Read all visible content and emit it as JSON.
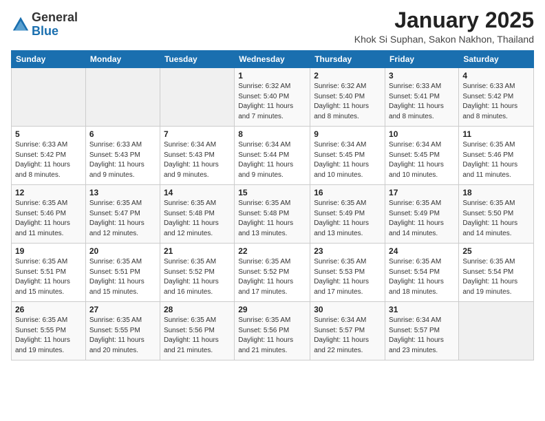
{
  "logo": {
    "general": "General",
    "blue": "Blue"
  },
  "header": {
    "title": "January 2025",
    "subtitle": "Khok Si Suphan, Sakon Nakhon, Thailand"
  },
  "weekdays": [
    "Sunday",
    "Monday",
    "Tuesday",
    "Wednesday",
    "Thursday",
    "Friday",
    "Saturday"
  ],
  "weeks": [
    [
      {
        "day": "",
        "content": ""
      },
      {
        "day": "",
        "content": ""
      },
      {
        "day": "",
        "content": ""
      },
      {
        "day": "1",
        "content": "Sunrise: 6:32 AM\nSunset: 5:40 PM\nDaylight: 11 hours and 7 minutes."
      },
      {
        "day": "2",
        "content": "Sunrise: 6:32 AM\nSunset: 5:40 PM\nDaylight: 11 hours and 8 minutes."
      },
      {
        "day": "3",
        "content": "Sunrise: 6:33 AM\nSunset: 5:41 PM\nDaylight: 11 hours and 8 minutes."
      },
      {
        "day": "4",
        "content": "Sunrise: 6:33 AM\nSunset: 5:42 PM\nDaylight: 11 hours and 8 minutes."
      }
    ],
    [
      {
        "day": "5",
        "content": "Sunrise: 6:33 AM\nSunset: 5:42 PM\nDaylight: 11 hours and 8 minutes."
      },
      {
        "day": "6",
        "content": "Sunrise: 6:33 AM\nSunset: 5:43 PM\nDaylight: 11 hours and 9 minutes."
      },
      {
        "day": "7",
        "content": "Sunrise: 6:34 AM\nSunset: 5:43 PM\nDaylight: 11 hours and 9 minutes."
      },
      {
        "day": "8",
        "content": "Sunrise: 6:34 AM\nSunset: 5:44 PM\nDaylight: 11 hours and 9 minutes."
      },
      {
        "day": "9",
        "content": "Sunrise: 6:34 AM\nSunset: 5:45 PM\nDaylight: 11 hours and 10 minutes."
      },
      {
        "day": "10",
        "content": "Sunrise: 6:34 AM\nSunset: 5:45 PM\nDaylight: 11 hours and 10 minutes."
      },
      {
        "day": "11",
        "content": "Sunrise: 6:35 AM\nSunset: 5:46 PM\nDaylight: 11 hours and 11 minutes."
      }
    ],
    [
      {
        "day": "12",
        "content": "Sunrise: 6:35 AM\nSunset: 5:46 PM\nDaylight: 11 hours and 11 minutes."
      },
      {
        "day": "13",
        "content": "Sunrise: 6:35 AM\nSunset: 5:47 PM\nDaylight: 11 hours and 12 minutes."
      },
      {
        "day": "14",
        "content": "Sunrise: 6:35 AM\nSunset: 5:48 PM\nDaylight: 11 hours and 12 minutes."
      },
      {
        "day": "15",
        "content": "Sunrise: 6:35 AM\nSunset: 5:48 PM\nDaylight: 11 hours and 13 minutes."
      },
      {
        "day": "16",
        "content": "Sunrise: 6:35 AM\nSunset: 5:49 PM\nDaylight: 11 hours and 13 minutes."
      },
      {
        "day": "17",
        "content": "Sunrise: 6:35 AM\nSunset: 5:49 PM\nDaylight: 11 hours and 14 minutes."
      },
      {
        "day": "18",
        "content": "Sunrise: 6:35 AM\nSunset: 5:50 PM\nDaylight: 11 hours and 14 minutes."
      }
    ],
    [
      {
        "day": "19",
        "content": "Sunrise: 6:35 AM\nSunset: 5:51 PM\nDaylight: 11 hours and 15 minutes."
      },
      {
        "day": "20",
        "content": "Sunrise: 6:35 AM\nSunset: 5:51 PM\nDaylight: 11 hours and 15 minutes."
      },
      {
        "day": "21",
        "content": "Sunrise: 6:35 AM\nSunset: 5:52 PM\nDaylight: 11 hours and 16 minutes."
      },
      {
        "day": "22",
        "content": "Sunrise: 6:35 AM\nSunset: 5:52 PM\nDaylight: 11 hours and 17 minutes."
      },
      {
        "day": "23",
        "content": "Sunrise: 6:35 AM\nSunset: 5:53 PM\nDaylight: 11 hours and 17 minutes."
      },
      {
        "day": "24",
        "content": "Sunrise: 6:35 AM\nSunset: 5:54 PM\nDaylight: 11 hours and 18 minutes."
      },
      {
        "day": "25",
        "content": "Sunrise: 6:35 AM\nSunset: 5:54 PM\nDaylight: 11 hours and 19 minutes."
      }
    ],
    [
      {
        "day": "26",
        "content": "Sunrise: 6:35 AM\nSunset: 5:55 PM\nDaylight: 11 hours and 19 minutes."
      },
      {
        "day": "27",
        "content": "Sunrise: 6:35 AM\nSunset: 5:55 PM\nDaylight: 11 hours and 20 minutes."
      },
      {
        "day": "28",
        "content": "Sunrise: 6:35 AM\nSunset: 5:56 PM\nDaylight: 11 hours and 21 minutes."
      },
      {
        "day": "29",
        "content": "Sunrise: 6:35 AM\nSunset: 5:56 PM\nDaylight: 11 hours and 21 minutes."
      },
      {
        "day": "30",
        "content": "Sunrise: 6:34 AM\nSunset: 5:57 PM\nDaylight: 11 hours and 22 minutes."
      },
      {
        "day": "31",
        "content": "Sunrise: 6:34 AM\nSunset: 5:57 PM\nDaylight: 11 hours and 23 minutes."
      },
      {
        "day": "",
        "content": ""
      }
    ]
  ]
}
